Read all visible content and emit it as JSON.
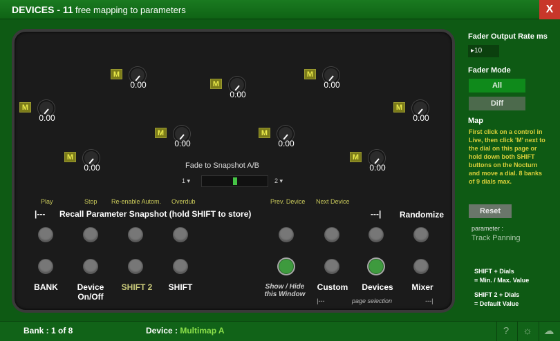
{
  "window": {
    "title": "DEVICES - 11",
    "subtitle": "free mapping to parameters",
    "close_label": "X"
  },
  "dials": [
    {
      "m": "M",
      "value": "0.00"
    },
    {
      "m": "M",
      "value": "0.00"
    },
    {
      "m": "M",
      "value": "0.00"
    },
    {
      "m": "M",
      "value": "0.00"
    },
    {
      "m": "M",
      "value": "0.00"
    },
    {
      "m": "M",
      "value": "0.00"
    },
    {
      "m": "M",
      "value": "0.00"
    },
    {
      "m": "M",
      "value": "0.00"
    },
    {
      "m": "M",
      "value": "0.00"
    }
  ],
  "fade": {
    "label": "Fade to Snapshot A/B",
    "snap_a": "1 ▾",
    "snap_b": "2 ▾",
    "position": 0.5
  },
  "top_labels": {
    "play": "Play",
    "stop": "Stop",
    "reenable": "Re-enable Autom.",
    "overdub": "Overdub",
    "prev_device": "Prev. Device",
    "next_device": "Next Device"
  },
  "recall": {
    "arrow_left": "|---",
    "label": "Recall Parameter Snapshot (hold SHIFT to store)",
    "arrow_right": "---|",
    "randomize": "Randomize"
  },
  "bottom_labels": {
    "bank": "BANK",
    "device_onoff": "Device\nOn/Off",
    "shift2": "SHIFT 2",
    "shift": "SHIFT",
    "show_hide": "Show / Hide\nthis Window",
    "custom": "Custom",
    "devices": "Devices",
    "mixer": "Mixer",
    "page_left": "|---",
    "page_selection": "page selection",
    "page_right": "---|"
  },
  "right": {
    "fader_rate_label": "Fader Output Rate ms",
    "fader_rate_value": "▸10",
    "fader_mode_label": "Fader Mode",
    "mode_all": "All",
    "mode_diff": "Diff",
    "map_label": "Map",
    "map_text": "First click on a control in Live, then click 'M' next to the dial on this page or hold down both SHIFT buttons on the Nocturn and move a dial. 8 banks of 9 dials max.",
    "reset": "Reset",
    "parameter_label": "parameter :",
    "parameter_value": "Track Panning",
    "hint1_line1": "SHIFT  +  Dials",
    "hint1_line2": "=  Min. / Max. Value",
    "hint2_line1": "SHIFT 2  +  Dials",
    "hint2_line2": "=  Default Value"
  },
  "status": {
    "bank_label": "Bank : 1 of 8",
    "device_label": "Device : ",
    "device_value": "Multimap A"
  },
  "icons": [
    "help-icon",
    "sun-icon",
    "cloud-icon"
  ],
  "colors": {
    "background": "#0e5a14",
    "close": "#c8372a",
    "accent_green": "#3e9a3e",
    "m_button": "#7c7c1a"
  }
}
